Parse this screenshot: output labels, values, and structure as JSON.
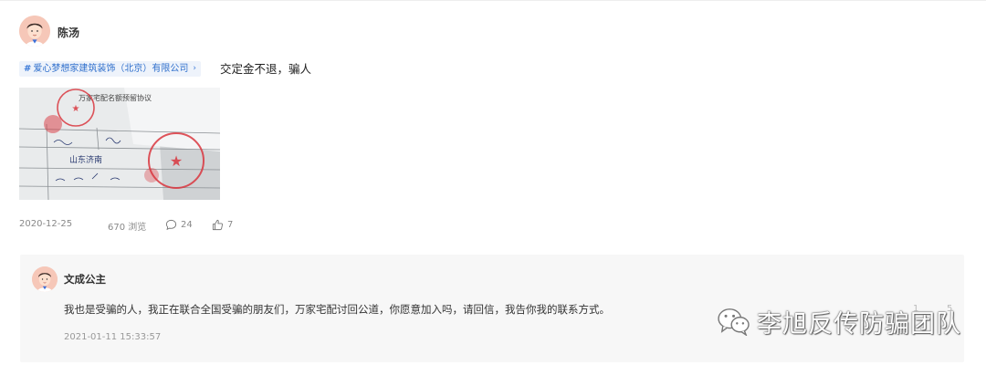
{
  "post": {
    "author": "陈汤",
    "tag_label": "爱心梦想家建筑装饰（北京）有限公司",
    "tag_arrow": "›",
    "text": "交定金不退，骗人",
    "image": {
      "title": "万家宅配名额预留协议",
      "handwriting": "山东济南"
    },
    "date": "2020-12-25",
    "views": "670 浏览",
    "comments": "24",
    "likes": "7"
  },
  "reply": {
    "author": "文成公主",
    "text": "我也是受骗的人，我正在联合全国受骗的朋友们，万家宅配讨回公道，你愿意加入吗，请回信，我告你我的联系方式。",
    "time": "2021-01-11 15:33:57",
    "faint_count_a": "1",
    "faint_count_b": "5"
  },
  "watermark": {
    "text": "李旭反传防骗团队"
  },
  "colors": {
    "tag_blue": "#2f6fcc",
    "tag_bg": "#eef3fb",
    "reply_bg": "#f7f7f7",
    "stamp_red": "#d9363e"
  }
}
